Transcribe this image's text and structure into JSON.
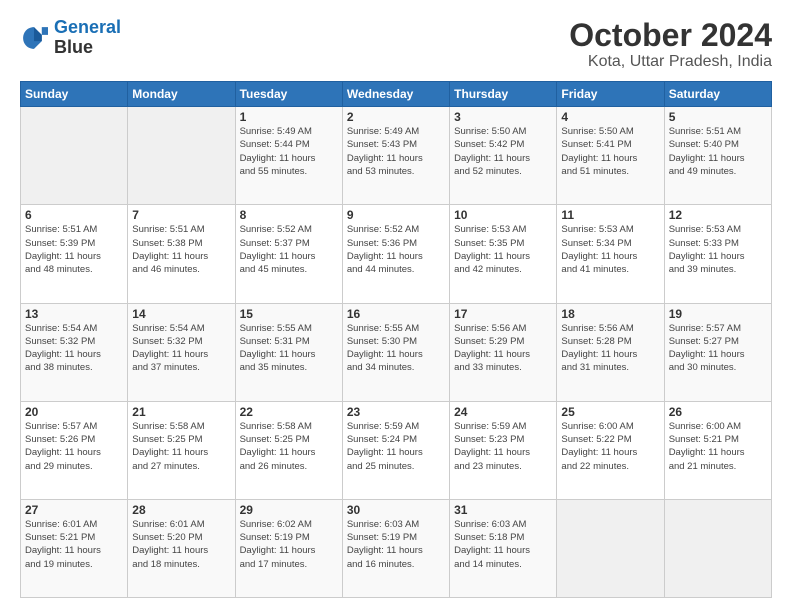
{
  "header": {
    "logo_line1": "General",
    "logo_line2": "Blue",
    "title": "October 2024",
    "subtitle": "Kota, Uttar Pradesh, India"
  },
  "weekdays": [
    "Sunday",
    "Monday",
    "Tuesday",
    "Wednesday",
    "Thursday",
    "Friday",
    "Saturday"
  ],
  "weeks": [
    [
      {
        "day": "",
        "info": ""
      },
      {
        "day": "",
        "info": ""
      },
      {
        "day": "1",
        "info": "Sunrise: 5:49 AM\nSunset: 5:44 PM\nDaylight: 11 hours\nand 55 minutes."
      },
      {
        "day": "2",
        "info": "Sunrise: 5:49 AM\nSunset: 5:43 PM\nDaylight: 11 hours\nand 53 minutes."
      },
      {
        "day": "3",
        "info": "Sunrise: 5:50 AM\nSunset: 5:42 PM\nDaylight: 11 hours\nand 52 minutes."
      },
      {
        "day": "4",
        "info": "Sunrise: 5:50 AM\nSunset: 5:41 PM\nDaylight: 11 hours\nand 51 minutes."
      },
      {
        "day": "5",
        "info": "Sunrise: 5:51 AM\nSunset: 5:40 PM\nDaylight: 11 hours\nand 49 minutes."
      }
    ],
    [
      {
        "day": "6",
        "info": "Sunrise: 5:51 AM\nSunset: 5:39 PM\nDaylight: 11 hours\nand 48 minutes."
      },
      {
        "day": "7",
        "info": "Sunrise: 5:51 AM\nSunset: 5:38 PM\nDaylight: 11 hours\nand 46 minutes."
      },
      {
        "day": "8",
        "info": "Sunrise: 5:52 AM\nSunset: 5:37 PM\nDaylight: 11 hours\nand 45 minutes."
      },
      {
        "day": "9",
        "info": "Sunrise: 5:52 AM\nSunset: 5:36 PM\nDaylight: 11 hours\nand 44 minutes."
      },
      {
        "day": "10",
        "info": "Sunrise: 5:53 AM\nSunset: 5:35 PM\nDaylight: 11 hours\nand 42 minutes."
      },
      {
        "day": "11",
        "info": "Sunrise: 5:53 AM\nSunset: 5:34 PM\nDaylight: 11 hours\nand 41 minutes."
      },
      {
        "day": "12",
        "info": "Sunrise: 5:53 AM\nSunset: 5:33 PM\nDaylight: 11 hours\nand 39 minutes."
      }
    ],
    [
      {
        "day": "13",
        "info": "Sunrise: 5:54 AM\nSunset: 5:32 PM\nDaylight: 11 hours\nand 38 minutes."
      },
      {
        "day": "14",
        "info": "Sunrise: 5:54 AM\nSunset: 5:32 PM\nDaylight: 11 hours\nand 37 minutes."
      },
      {
        "day": "15",
        "info": "Sunrise: 5:55 AM\nSunset: 5:31 PM\nDaylight: 11 hours\nand 35 minutes."
      },
      {
        "day": "16",
        "info": "Sunrise: 5:55 AM\nSunset: 5:30 PM\nDaylight: 11 hours\nand 34 minutes."
      },
      {
        "day": "17",
        "info": "Sunrise: 5:56 AM\nSunset: 5:29 PM\nDaylight: 11 hours\nand 33 minutes."
      },
      {
        "day": "18",
        "info": "Sunrise: 5:56 AM\nSunset: 5:28 PM\nDaylight: 11 hours\nand 31 minutes."
      },
      {
        "day": "19",
        "info": "Sunrise: 5:57 AM\nSunset: 5:27 PM\nDaylight: 11 hours\nand 30 minutes."
      }
    ],
    [
      {
        "day": "20",
        "info": "Sunrise: 5:57 AM\nSunset: 5:26 PM\nDaylight: 11 hours\nand 29 minutes."
      },
      {
        "day": "21",
        "info": "Sunrise: 5:58 AM\nSunset: 5:25 PM\nDaylight: 11 hours\nand 27 minutes."
      },
      {
        "day": "22",
        "info": "Sunrise: 5:58 AM\nSunset: 5:25 PM\nDaylight: 11 hours\nand 26 minutes."
      },
      {
        "day": "23",
        "info": "Sunrise: 5:59 AM\nSunset: 5:24 PM\nDaylight: 11 hours\nand 25 minutes."
      },
      {
        "day": "24",
        "info": "Sunrise: 5:59 AM\nSunset: 5:23 PM\nDaylight: 11 hours\nand 23 minutes."
      },
      {
        "day": "25",
        "info": "Sunrise: 6:00 AM\nSunset: 5:22 PM\nDaylight: 11 hours\nand 22 minutes."
      },
      {
        "day": "26",
        "info": "Sunrise: 6:00 AM\nSunset: 5:21 PM\nDaylight: 11 hours\nand 21 minutes."
      }
    ],
    [
      {
        "day": "27",
        "info": "Sunrise: 6:01 AM\nSunset: 5:21 PM\nDaylight: 11 hours\nand 19 minutes."
      },
      {
        "day": "28",
        "info": "Sunrise: 6:01 AM\nSunset: 5:20 PM\nDaylight: 11 hours\nand 18 minutes."
      },
      {
        "day": "29",
        "info": "Sunrise: 6:02 AM\nSunset: 5:19 PM\nDaylight: 11 hours\nand 17 minutes."
      },
      {
        "day": "30",
        "info": "Sunrise: 6:03 AM\nSunset: 5:19 PM\nDaylight: 11 hours\nand 16 minutes."
      },
      {
        "day": "31",
        "info": "Sunrise: 6:03 AM\nSunset: 5:18 PM\nDaylight: 11 hours\nand 14 minutes."
      },
      {
        "day": "",
        "info": ""
      },
      {
        "day": "",
        "info": ""
      }
    ]
  ]
}
